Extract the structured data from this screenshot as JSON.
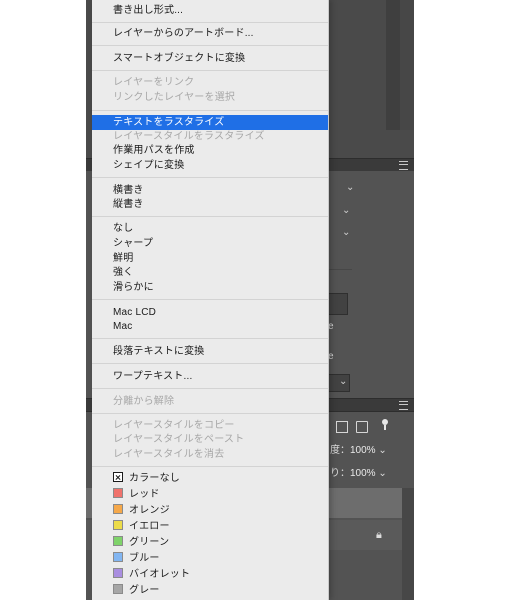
{
  "panels": {
    "mid_fragments": [
      "e",
      "e"
    ],
    "opacity": {
      "label": "度：",
      "value": "100%"
    },
    "fill": {
      "label": "り：",
      "value": "100%"
    },
    "lock_icon": "lock-icon"
  },
  "menu": {
    "groups": [
      [
        "書き出し形式..."
      ],
      [
        "レイヤーからのアートボード..."
      ],
      [
        "スマートオブジェクトに変換"
      ],
      [
        "レイヤーをリンク",
        "リンクしたレイヤーを選択"
      ],
      [
        "テキストをラスタライズ",
        "レイヤースタイルをラスタライズ",
        "作業用パスを作成",
        "シェイプに変換"
      ],
      [
        "横書き",
        "縦書き"
      ],
      [
        "なし",
        "シャープ",
        "鮮明",
        "強く",
        "滑らかに"
      ],
      [
        "Mac LCD",
        "Mac"
      ],
      [
        "段落テキストに変換"
      ],
      [
        "ワープテキスト..."
      ],
      [
        "分離から解除"
      ],
      [
        "レイヤースタイルをコピー",
        "レイヤースタイルをペースト",
        "レイヤースタイルを消去"
      ]
    ],
    "highlighted": "テキストをラスタライズ",
    "disabled": [
      "レイヤーをリンク",
      "リンクしたレイヤーを選択",
      "レイヤースタイルをラスタライズ",
      "分離から解除",
      "レイヤースタイルをコピー",
      "レイヤースタイルをペースト",
      "レイヤースタイルを消去"
    ],
    "colors": [
      {
        "label": "カラーなし",
        "swatch": "none"
      },
      {
        "label": "レッド",
        "swatch": "#f0726c"
      },
      {
        "label": "オレンジ",
        "swatch": "#f5a84a"
      },
      {
        "label": "イエロー",
        "swatch": "#ecdc4a"
      },
      {
        "label": "グリーン",
        "swatch": "#7fd36a"
      },
      {
        "label": "ブルー",
        "swatch": "#82b6f2"
      },
      {
        "label": "バイオレット",
        "swatch": "#a98ee0"
      },
      {
        "label": "グレー",
        "swatch": "#a6a6a6"
      }
    ],
    "highlight_color": "#1f6fe6"
  }
}
